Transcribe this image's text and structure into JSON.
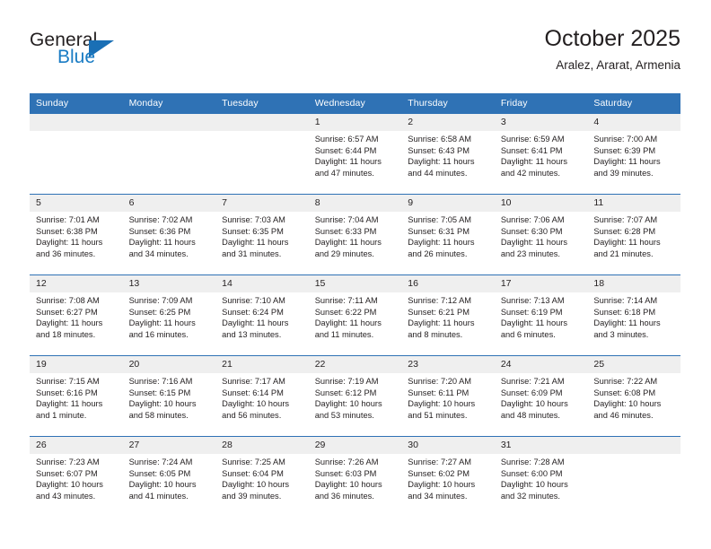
{
  "brand": {
    "word_general": "General",
    "word_blue": "Blue",
    "accent_color": "#1a6fb5"
  },
  "header": {
    "title": "October 2025",
    "location": "Aralez, Ararat, Armenia"
  },
  "calendar": {
    "header_color": "#2f72b5",
    "daynum_bg": "#efefef",
    "weekday_labels": [
      "Sunday",
      "Monday",
      "Tuesday",
      "Wednesday",
      "Thursday",
      "Friday",
      "Saturday"
    ],
    "weeks": [
      [
        {
          "day": "",
          "sunrise": "",
          "sunset": "",
          "daylight_line1": "",
          "daylight_line2": ""
        },
        {
          "day": "",
          "sunrise": "",
          "sunset": "",
          "daylight_line1": "",
          "daylight_line2": ""
        },
        {
          "day": "",
          "sunrise": "",
          "sunset": "",
          "daylight_line1": "",
          "daylight_line2": ""
        },
        {
          "day": "1",
          "sunrise": "Sunrise: 6:57 AM",
          "sunset": "Sunset: 6:44 PM",
          "daylight_line1": "Daylight: 11 hours",
          "daylight_line2": "and 47 minutes."
        },
        {
          "day": "2",
          "sunrise": "Sunrise: 6:58 AM",
          "sunset": "Sunset: 6:43 PM",
          "daylight_line1": "Daylight: 11 hours",
          "daylight_line2": "and 44 minutes."
        },
        {
          "day": "3",
          "sunrise": "Sunrise: 6:59 AM",
          "sunset": "Sunset: 6:41 PM",
          "daylight_line1": "Daylight: 11 hours",
          "daylight_line2": "and 42 minutes."
        },
        {
          "day": "4",
          "sunrise": "Sunrise: 7:00 AM",
          "sunset": "Sunset: 6:39 PM",
          "daylight_line1": "Daylight: 11 hours",
          "daylight_line2": "and 39 minutes."
        }
      ],
      [
        {
          "day": "5",
          "sunrise": "Sunrise: 7:01 AM",
          "sunset": "Sunset: 6:38 PM",
          "daylight_line1": "Daylight: 11 hours",
          "daylight_line2": "and 36 minutes."
        },
        {
          "day": "6",
          "sunrise": "Sunrise: 7:02 AM",
          "sunset": "Sunset: 6:36 PM",
          "daylight_line1": "Daylight: 11 hours",
          "daylight_line2": "and 34 minutes."
        },
        {
          "day": "7",
          "sunrise": "Sunrise: 7:03 AM",
          "sunset": "Sunset: 6:35 PM",
          "daylight_line1": "Daylight: 11 hours",
          "daylight_line2": "and 31 minutes."
        },
        {
          "day": "8",
          "sunrise": "Sunrise: 7:04 AM",
          "sunset": "Sunset: 6:33 PM",
          "daylight_line1": "Daylight: 11 hours",
          "daylight_line2": "and 29 minutes."
        },
        {
          "day": "9",
          "sunrise": "Sunrise: 7:05 AM",
          "sunset": "Sunset: 6:31 PM",
          "daylight_line1": "Daylight: 11 hours",
          "daylight_line2": "and 26 minutes."
        },
        {
          "day": "10",
          "sunrise": "Sunrise: 7:06 AM",
          "sunset": "Sunset: 6:30 PM",
          "daylight_line1": "Daylight: 11 hours",
          "daylight_line2": "and 23 minutes."
        },
        {
          "day": "11",
          "sunrise": "Sunrise: 7:07 AM",
          "sunset": "Sunset: 6:28 PM",
          "daylight_line1": "Daylight: 11 hours",
          "daylight_line2": "and 21 minutes."
        }
      ],
      [
        {
          "day": "12",
          "sunrise": "Sunrise: 7:08 AM",
          "sunset": "Sunset: 6:27 PM",
          "daylight_line1": "Daylight: 11 hours",
          "daylight_line2": "and 18 minutes."
        },
        {
          "day": "13",
          "sunrise": "Sunrise: 7:09 AM",
          "sunset": "Sunset: 6:25 PM",
          "daylight_line1": "Daylight: 11 hours",
          "daylight_line2": "and 16 minutes."
        },
        {
          "day": "14",
          "sunrise": "Sunrise: 7:10 AM",
          "sunset": "Sunset: 6:24 PM",
          "daylight_line1": "Daylight: 11 hours",
          "daylight_line2": "and 13 minutes."
        },
        {
          "day": "15",
          "sunrise": "Sunrise: 7:11 AM",
          "sunset": "Sunset: 6:22 PM",
          "daylight_line1": "Daylight: 11 hours",
          "daylight_line2": "and 11 minutes."
        },
        {
          "day": "16",
          "sunrise": "Sunrise: 7:12 AM",
          "sunset": "Sunset: 6:21 PM",
          "daylight_line1": "Daylight: 11 hours",
          "daylight_line2": "and 8 minutes."
        },
        {
          "day": "17",
          "sunrise": "Sunrise: 7:13 AM",
          "sunset": "Sunset: 6:19 PM",
          "daylight_line1": "Daylight: 11 hours",
          "daylight_line2": "and 6 minutes."
        },
        {
          "day": "18",
          "sunrise": "Sunrise: 7:14 AM",
          "sunset": "Sunset: 6:18 PM",
          "daylight_line1": "Daylight: 11 hours",
          "daylight_line2": "and 3 minutes."
        }
      ],
      [
        {
          "day": "19",
          "sunrise": "Sunrise: 7:15 AM",
          "sunset": "Sunset: 6:16 PM",
          "daylight_line1": "Daylight: 11 hours",
          "daylight_line2": "and 1 minute."
        },
        {
          "day": "20",
          "sunrise": "Sunrise: 7:16 AM",
          "sunset": "Sunset: 6:15 PM",
          "daylight_line1": "Daylight: 10 hours",
          "daylight_line2": "and 58 minutes."
        },
        {
          "day": "21",
          "sunrise": "Sunrise: 7:17 AM",
          "sunset": "Sunset: 6:14 PM",
          "daylight_line1": "Daylight: 10 hours",
          "daylight_line2": "and 56 minutes."
        },
        {
          "day": "22",
          "sunrise": "Sunrise: 7:19 AM",
          "sunset": "Sunset: 6:12 PM",
          "daylight_line1": "Daylight: 10 hours",
          "daylight_line2": "and 53 minutes."
        },
        {
          "day": "23",
          "sunrise": "Sunrise: 7:20 AM",
          "sunset": "Sunset: 6:11 PM",
          "daylight_line1": "Daylight: 10 hours",
          "daylight_line2": "and 51 minutes."
        },
        {
          "day": "24",
          "sunrise": "Sunrise: 7:21 AM",
          "sunset": "Sunset: 6:09 PM",
          "daylight_line1": "Daylight: 10 hours",
          "daylight_line2": "and 48 minutes."
        },
        {
          "day": "25",
          "sunrise": "Sunrise: 7:22 AM",
          "sunset": "Sunset: 6:08 PM",
          "daylight_line1": "Daylight: 10 hours",
          "daylight_line2": "and 46 minutes."
        }
      ],
      [
        {
          "day": "26",
          "sunrise": "Sunrise: 7:23 AM",
          "sunset": "Sunset: 6:07 PM",
          "daylight_line1": "Daylight: 10 hours",
          "daylight_line2": "and 43 minutes."
        },
        {
          "day": "27",
          "sunrise": "Sunrise: 7:24 AM",
          "sunset": "Sunset: 6:05 PM",
          "daylight_line1": "Daylight: 10 hours",
          "daylight_line2": "and 41 minutes."
        },
        {
          "day": "28",
          "sunrise": "Sunrise: 7:25 AM",
          "sunset": "Sunset: 6:04 PM",
          "daylight_line1": "Daylight: 10 hours",
          "daylight_line2": "and 39 minutes."
        },
        {
          "day": "29",
          "sunrise": "Sunrise: 7:26 AM",
          "sunset": "Sunset: 6:03 PM",
          "daylight_line1": "Daylight: 10 hours",
          "daylight_line2": "and 36 minutes."
        },
        {
          "day": "30",
          "sunrise": "Sunrise: 7:27 AM",
          "sunset": "Sunset: 6:02 PM",
          "daylight_line1": "Daylight: 10 hours",
          "daylight_line2": "and 34 minutes."
        },
        {
          "day": "31",
          "sunrise": "Sunrise: 7:28 AM",
          "sunset": "Sunset: 6:00 PM",
          "daylight_line1": "Daylight: 10 hours",
          "daylight_line2": "and 32 minutes."
        },
        {
          "day": "",
          "sunrise": "",
          "sunset": "",
          "daylight_line1": "",
          "daylight_line2": ""
        }
      ]
    ]
  }
}
